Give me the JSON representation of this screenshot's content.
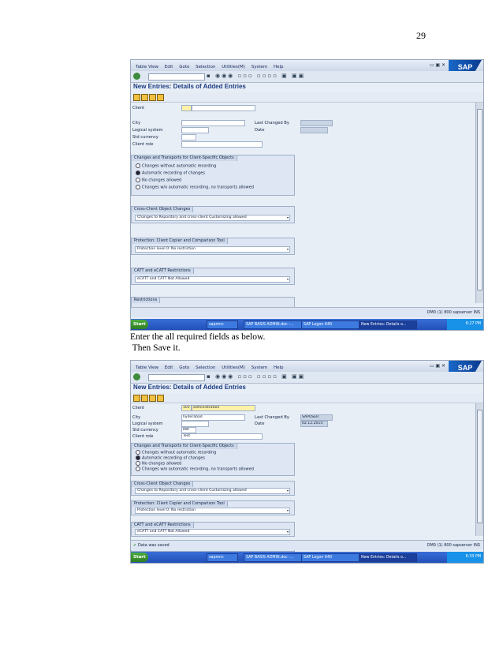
{
  "page_number": "29",
  "captions": [
    "Enter the all required fields as below.",
    " Then Save it."
  ],
  "common": {
    "menu": [
      "Table View",
      "Edit",
      "Goto",
      "Selection",
      "Utilities(M)",
      "System",
      "Help"
    ],
    "logo": "SAP",
    "title": "New Entries: Details of Added Entries",
    "labels": {
      "client": "Client",
      "city": "City",
      "logical_system": "Logical system",
      "std_currency": "Std currency",
      "client_role": "Client role",
      "last_changed_by": "Last Changed By",
      "date": "Date"
    },
    "group_changes": {
      "title": "Changes and Transports for Client-Specific Objects",
      "options": [
        "Changes without automatic recording",
        "Automatic recording of changes",
        "No changes allowed",
        "Changes w/o automatic recording, no transports allowed"
      ]
    },
    "group_cross": {
      "title": "Cross-Client Object Changes",
      "value": "Changes to Repository and cross-client Customizing allowed"
    },
    "group_protection": {
      "title": "Protection: Client Copier and Comparison Tool",
      "value": "Protection level 0: No restriction"
    },
    "group_catt": {
      "title": "CATT and eCATT Restrictions",
      "value": "eCATT and CATT Not Allowed"
    },
    "group_restrictions": {
      "title": "Restrictions"
    },
    "status_right": "DM0 (1) 800  sapserver  INS",
    "taskbar": {
      "start": "Start",
      "tasks": [
        "sapmnc",
        "SAP BASIS ADMIN.doc -...",
        "SAP Logon 640",
        "New Entries: Details o..."
      ]
    }
  },
  "screen1": {
    "client": "",
    "client_name": "",
    "city": "",
    "logical_system": "",
    "std_currency": "",
    "client_role": "",
    "last_changed_by": "",
    "date": "",
    "status_message": "",
    "clock": "6:27 PM"
  },
  "screen2": {
    "client": "101",
    "client_name": "administration",
    "city": "hyderabad",
    "logical_system": "",
    "std_currency": "INR",
    "client_role": "Test",
    "last_changed_by": "SAPUSER",
    "date": "02.12.2015",
    "status_message": "Data was saved",
    "clock": "6:33 PM"
  }
}
